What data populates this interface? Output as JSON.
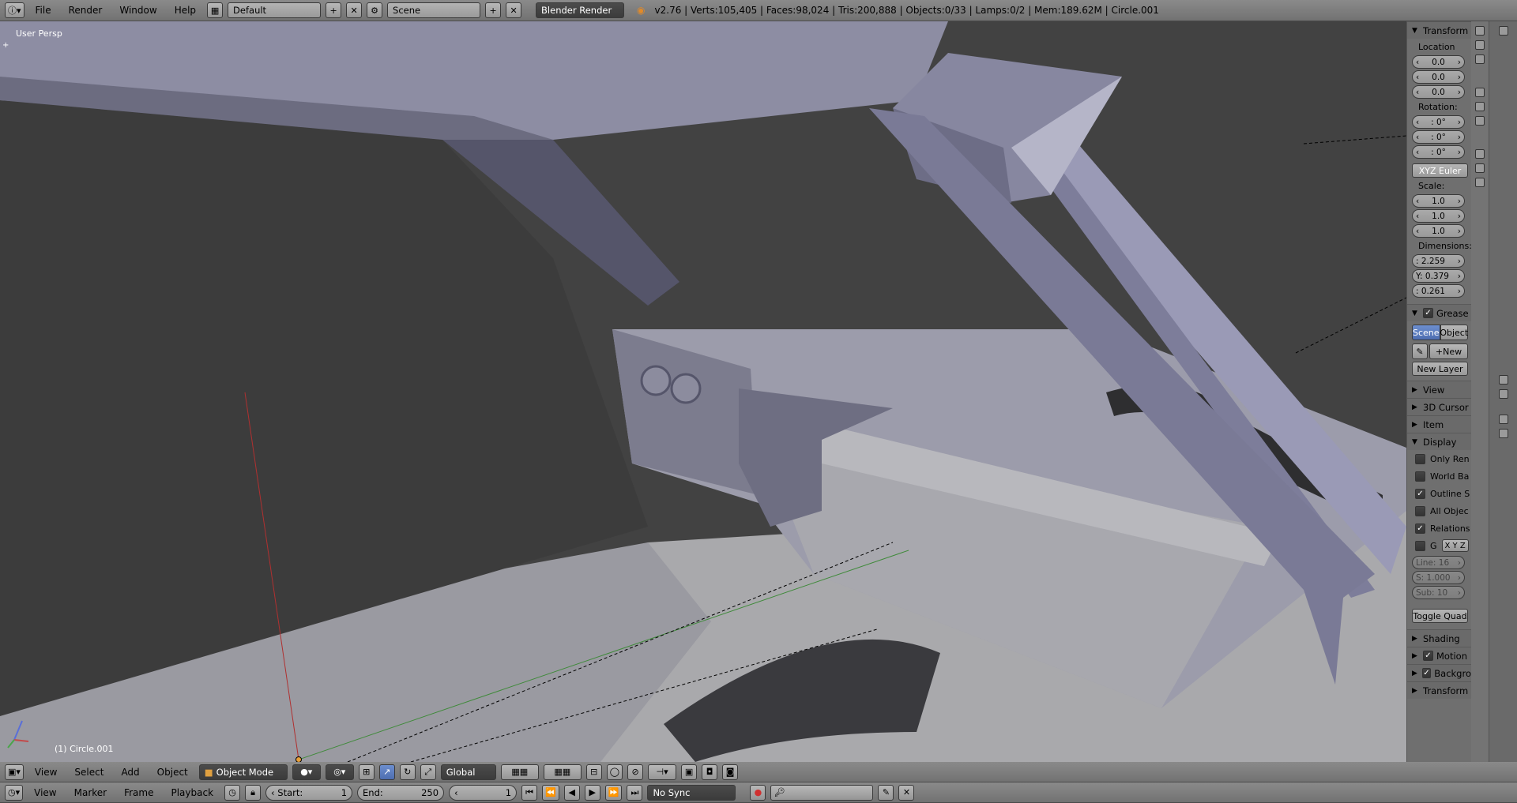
{
  "topbar": {
    "menus": [
      "File",
      "Render",
      "Window",
      "Help"
    ],
    "screen_layout": "Default",
    "scene": "Scene",
    "render_engine": "Blender Render",
    "stats": "v2.76 | Verts:105,405 | Faces:98,024 | Tris:200,888 | Objects:0/33 | Lamps:0/2 | Mem:189.62M | Circle.001"
  },
  "viewport": {
    "view_label": "User Persp",
    "object_label": "(1) Circle.001"
  },
  "npanel": {
    "transform_header": "Transform",
    "location_label": "Location",
    "location": [
      "0.0",
      "0.0",
      "0.0"
    ],
    "rotation_label": "Rotation:",
    "rotation": [
      ": 0°",
      ": 0°",
      ": 0°"
    ],
    "rotation_mode": "XYZ Euler",
    "scale_label": "Scale:",
    "scale": [
      "1.0",
      "1.0",
      "1.0"
    ],
    "dimensions_label": "Dimensions:",
    "dimensions": [
      ":  2.259",
      "Y: 0.379",
      ":  0.261"
    ],
    "grease_header": "Grease",
    "grease_scene": "Scene",
    "grease_object": "Object",
    "grease_new": "New",
    "new_layer": "New Layer",
    "view_header": "View",
    "cursor_header": "3D Cursor",
    "item_header": "Item",
    "display_header": "Display",
    "display_checks": [
      {
        "label": "Only Ren",
        "checked": false
      },
      {
        "label": "World Ba",
        "checked": false
      },
      {
        "label": "Outline S",
        "checked": true
      },
      {
        "label": "All Objec",
        "checked": false
      },
      {
        "label": "Relations",
        "checked": true
      }
    ],
    "grid_label": "G",
    "axes": "X Y Z",
    "grid_line": "Line: 16",
    "grid_scale": "S: 1.000",
    "grid_sub": "Sub:  10",
    "toggle_quad": "Toggle Quad",
    "shading_header": "Shading",
    "motion_header": "Motion",
    "background_header": "Backgro",
    "transform2_header": "Transform"
  },
  "vpheader": {
    "menus": [
      "View",
      "Select",
      "Add",
      "Object"
    ],
    "mode": "Object Mode",
    "orientation": "Global"
  },
  "timeline": {
    "menus": [
      "View",
      "Marker",
      "Frame",
      "Playback"
    ],
    "start_label": "Start:",
    "start": "1",
    "end_label": "End:",
    "end": "250",
    "current": "1",
    "sync": "No Sync"
  },
  "colors": {
    "header": "#7a7a7a",
    "viewport": "#404040",
    "mesh": "#8a8aa0",
    "selected": "#5680c2"
  }
}
